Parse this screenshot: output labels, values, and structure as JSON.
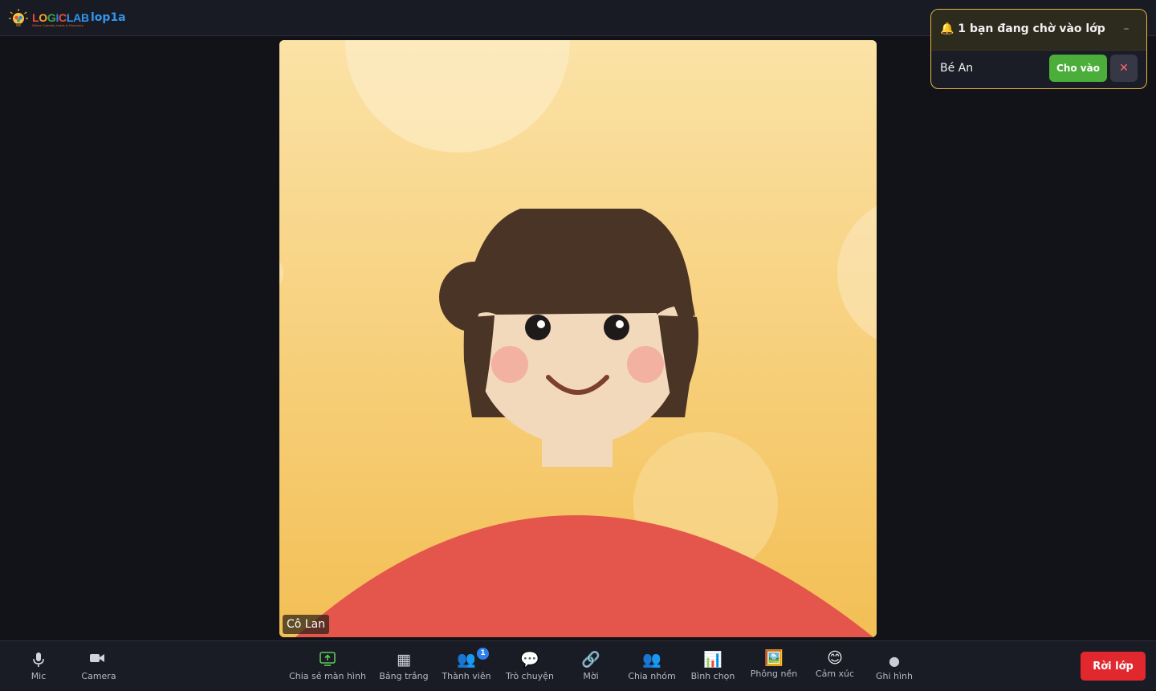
{
  "header": {
    "logo_letters": [
      "L",
      "O",
      "G",
      "I",
      "C",
      "L",
      "A",
      "B"
    ],
    "logo_tagline": "Where Curiosity Leads to Discovery",
    "room_name": "lop1a"
  },
  "video": {
    "participant_name": "Cô Lan"
  },
  "waiting_room": {
    "icon": "bell-icon",
    "title": "🔔 1 bạn đang chờ vào lớp",
    "minimize_label": "–",
    "guests": [
      {
        "name": "Bé An",
        "admit_label": "Cho vào",
        "deny_label": "✕"
      }
    ]
  },
  "toolbar": {
    "mic": {
      "label": "Mic",
      "icon": "microphone-icon"
    },
    "camera": {
      "label": "Camera",
      "icon": "camera-icon"
    },
    "share": {
      "label": "Chia sẻ màn hình",
      "icon": "share-screen-icon"
    },
    "whiteboard": {
      "label": "Bảng trắng",
      "icon": "whiteboard-icon",
      "glyph": "▦"
    },
    "members": {
      "label": "Thành viên",
      "icon": "members-icon",
      "glyph": "👥",
      "badge": "1"
    },
    "chat": {
      "label": "Trò chuyện",
      "icon": "chat-icon",
      "glyph": "💬"
    },
    "invite": {
      "label": "Mời",
      "icon": "link-icon",
      "glyph": "🔗"
    },
    "breakout": {
      "label": "Chia nhóm",
      "icon": "breakout-icon",
      "glyph": "👥"
    },
    "poll": {
      "label": "Bình chọn",
      "icon": "poll-icon",
      "glyph": "📊"
    },
    "background": {
      "label": "Phông nền",
      "icon": "background-icon",
      "glyph": "🖼️"
    },
    "reactions": {
      "label": "Cảm xúc",
      "icon": "emoji-icon",
      "glyph": "😊"
    },
    "record": {
      "label": "Ghi hình",
      "icon": "record-icon",
      "glyph": "●"
    },
    "leave_label": "Rời lớp"
  },
  "colors": {
    "accent_blue": "#2f96ef",
    "admit_green": "#4cae3a",
    "leave_red": "#e0282e",
    "panel_border": "#e8b73f",
    "video_bg": "#f7d98f",
    "shirt": "#e4564c",
    "hair": "#4a3426"
  }
}
